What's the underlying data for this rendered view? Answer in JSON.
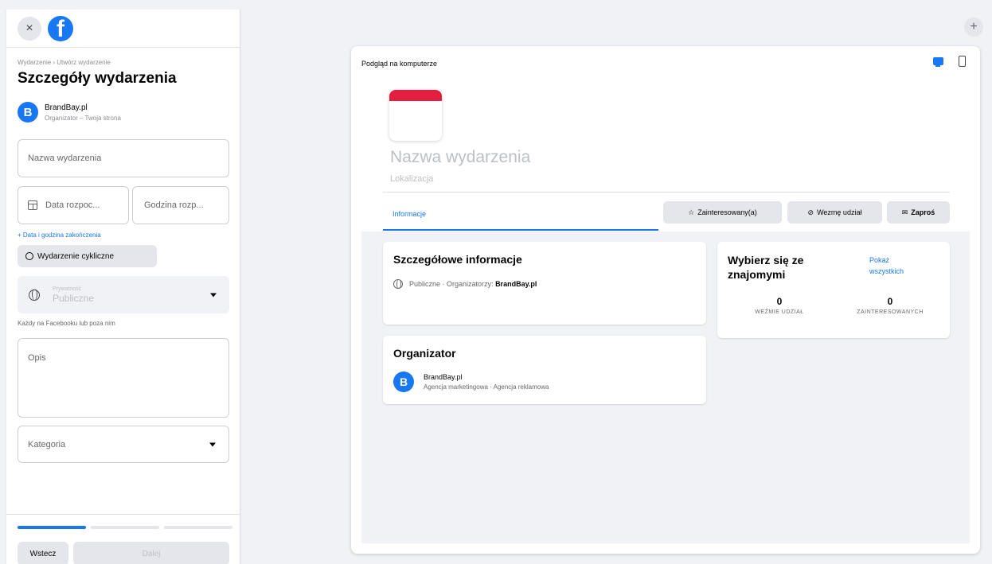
{
  "sidebar": {
    "close_icon": "×",
    "breadcrumb": "Wydarzenie › Utwórz wydarzenie",
    "title": "Szczegóły wydarzenia",
    "organizer": {
      "avatar_letter": "B",
      "name": "BrandBay.pl",
      "subtitle": "Organizator – Twoja strona"
    },
    "fields": {
      "event_name": "Nazwa wydarzenia",
      "start_date": "Data rozpoc...",
      "start_time": "Godzina rozp...",
      "add_end": "+ Data i godzina zakończenia",
      "recurring": "Wydarzenie cykliczne",
      "privacy_label": "Prywatność",
      "privacy_value": "Publiczne",
      "privacy_help": "Każdy na Facebooku lub poza nim",
      "description": "Opis",
      "category": "Kategoria"
    },
    "progress": {
      "step": 1,
      "total": 3
    },
    "buttons": {
      "back": "Wstecz",
      "next": "Dalej"
    }
  },
  "top_plus": "+",
  "preview": {
    "title": "Podgląd na komputerze",
    "event_name": "Nazwa wydarzenia",
    "location": "Lokalizacja",
    "tab_info": "Informacje",
    "actions": {
      "interested": "Zainteresowany(a)",
      "going": "Wezmę udział",
      "invite": "Zaproś"
    },
    "details": {
      "heading": "Szczegółowe informacje",
      "privacy": "Publiczne · Organizatorzy:",
      "organizers": "BrandBay.pl"
    },
    "organizer_card": {
      "heading": "Organizator",
      "avatar_letter": "B",
      "name": "BrandBay.pl",
      "subtitle": "Agencja marketingowa · Agencja reklamowa"
    },
    "friends": {
      "heading": "Wybierz się ze znajomymi",
      "show_all": "Pokaż wszystkich",
      "going_count": "0",
      "going_label": "WEŹMIE UDZIAŁ",
      "interested_count": "0",
      "interested_label": "ZAINTERESOWANYCH"
    }
  },
  "colors": {
    "accent": "#1877f2",
    "cover_red": "#e41e3f"
  }
}
